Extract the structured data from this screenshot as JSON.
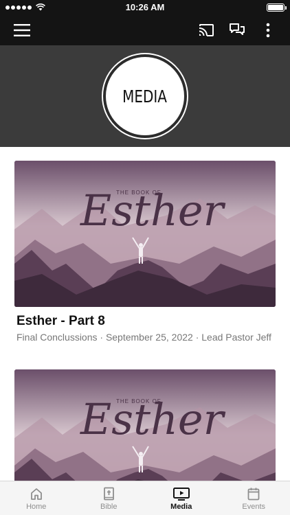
{
  "status_bar": {
    "time": "10:26 AM",
    "signal_dots": 5
  },
  "toolbar": {
    "menu_icon": "hamburger-menu-icon",
    "cast_icon": "cast-icon",
    "chat_icon": "chat-bubbles-icon",
    "more_icon": "more-vertical-icon"
  },
  "header": {
    "badge_text": "MEDIA"
  },
  "feed": {
    "items": [
      {
        "thumbnail_caption": "THE BOOK OF",
        "thumbnail_script": "Esther",
        "title": "Esther - Part 8",
        "meta": "Final Conclussions · September 25, 2022 · Lead Pastor Jeff"
      },
      {
        "thumbnail_caption": "THE BOOK OF",
        "thumbnail_script": "Esther"
      }
    ]
  },
  "tabs": [
    {
      "label": "Home",
      "icon": "home-icon",
      "active": false
    },
    {
      "label": "Bible",
      "icon": "bible-icon",
      "active": false
    },
    {
      "label": "Media",
      "icon": "media-play-icon",
      "active": true
    },
    {
      "label": "Events",
      "icon": "calendar-icon",
      "active": false
    }
  ],
  "colors": {
    "bar_background": "#141414",
    "header_background": "#3b3b3b",
    "tab_active": "#111111",
    "tab_inactive": "#8e8e8e"
  }
}
